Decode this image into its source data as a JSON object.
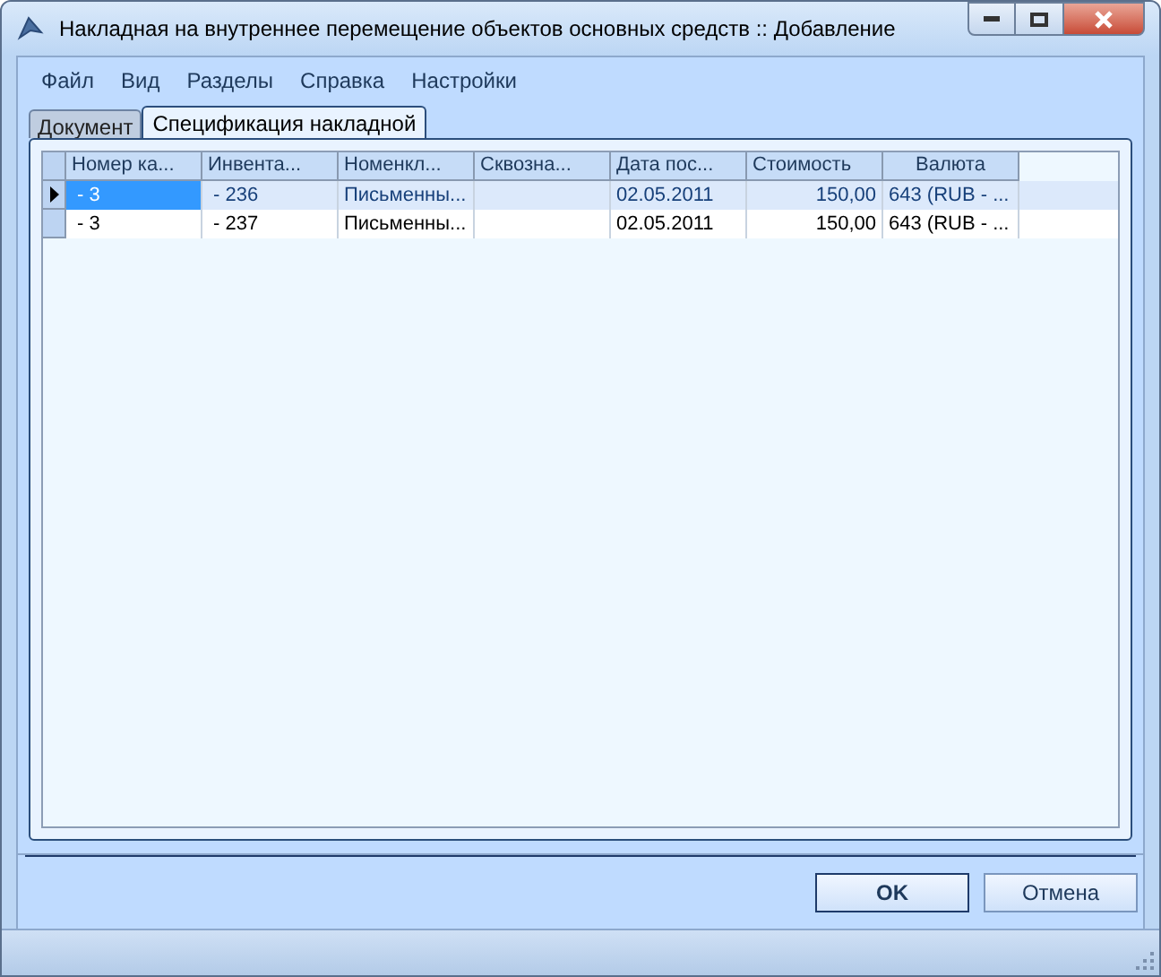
{
  "window": {
    "title": "Накладная на внутреннее перемещение объектов основных средств :: Добавление"
  },
  "menu": [
    "Файл",
    "Вид",
    "Разделы",
    "Справка",
    "Настройки"
  ],
  "tabs": [
    {
      "label": "Документ",
      "selected": false
    },
    {
      "label": "Спецификация накладной",
      "selected": true
    }
  ],
  "table": {
    "columns": [
      {
        "label": "Номер ка..."
      },
      {
        "label": "Инвента..."
      },
      {
        "label": "Номенкл..."
      },
      {
        "label": "Сквозна..."
      },
      {
        "label": "Дата пос..."
      },
      {
        "label": "Стоимость"
      },
      {
        "label": "Валюта"
      }
    ],
    "rows": [
      {
        "selected": true,
        "cells": [
          " - 3",
          " - 236",
          "Письменны...",
          "",
          "02.05.2011",
          "150,00",
          "643 (RUB - ..."
        ]
      },
      {
        "selected": false,
        "cells": [
          " - 3",
          " - 237",
          "Письменны...",
          "",
          "02.05.2011",
          "150,00",
          "643 (RUB - ..."
        ]
      }
    ]
  },
  "buttons": [
    {
      "label": "OK",
      "default": true
    },
    {
      "label": "Отмена",
      "default": false
    }
  ]
}
